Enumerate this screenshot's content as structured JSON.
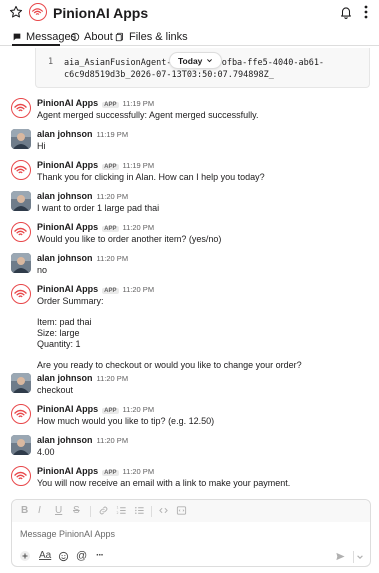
{
  "header": {
    "title": "PinionAI Apps"
  },
  "tabs": [
    {
      "label": "Messages"
    },
    {
      "label": "About"
    },
    {
      "label": "Files & links"
    }
  ],
  "code_block": {
    "line_number": "1",
    "line1": "aia_AsianFusionAgent-Ju",
    "line1b": "ofba-ffe5-4040-ab61-",
    "line2": "c6c9d8519d3b_2026-07-13T03:50:07.794898Z_"
  },
  "today_pill": {
    "label": "Today"
  },
  "messages": [
    {
      "sender": "PinionAI Apps",
      "badge": "APP",
      "time": "11:19 PM",
      "lines": [
        "Agent merged successfully: Agent merged successfully."
      ]
    },
    {
      "sender": "alan johnson",
      "time": "11:19 PM",
      "lines": [
        "Hi"
      ]
    },
    {
      "sender": "PinionAI Apps",
      "badge": "APP",
      "time": "11:19 PM",
      "lines": [
        "Thank you for clicking in Alan. How can I help you today?"
      ]
    },
    {
      "sender": "alan johnson",
      "time": "11:20 PM",
      "lines": [
        "I want to order 1 large pad thai"
      ]
    },
    {
      "sender": "PinionAI Apps",
      "badge": "APP",
      "time": "11:20 PM",
      "lines": [
        "Would you like to order another item? (yes/no)"
      ]
    },
    {
      "sender": "alan johnson",
      "time": "11:20 PM",
      "lines": [
        "no"
      ]
    },
    {
      "sender": "PinionAI Apps",
      "badge": "APP",
      "time": "11:20 PM",
      "lines": [
        "Order Summary:",
        "Item: pad thai",
        "Size: large",
        "Quantity: 1",
        "Are you ready to checkout or would you like to change your order?"
      ]
    },
    {
      "sender": "alan johnson",
      "time": "11:20 PM",
      "lines": [
        "checkout"
      ]
    },
    {
      "sender": "PinionAI Apps",
      "badge": "APP",
      "time": "11:20 PM",
      "lines": [
        "How much would you like to tip? (e.g. 12.50)"
      ]
    },
    {
      "sender": "alan johnson",
      "time": "11:20 PM",
      "lines": [
        "4.00"
      ]
    },
    {
      "sender": "PinionAI Apps",
      "badge": "APP",
      "time": "11:20 PM",
      "lines": [
        "You will now receive an email with a link to make your payment."
      ]
    }
  ],
  "composer": {
    "placeholder": "Message PinionAI Apps",
    "format_buttons": [
      "B",
      "I",
      "U",
      "S"
    ]
  },
  "colors": {
    "brand_red": "#e8474a",
    "text": "#1d1c1d",
    "muted": "#616061"
  }
}
